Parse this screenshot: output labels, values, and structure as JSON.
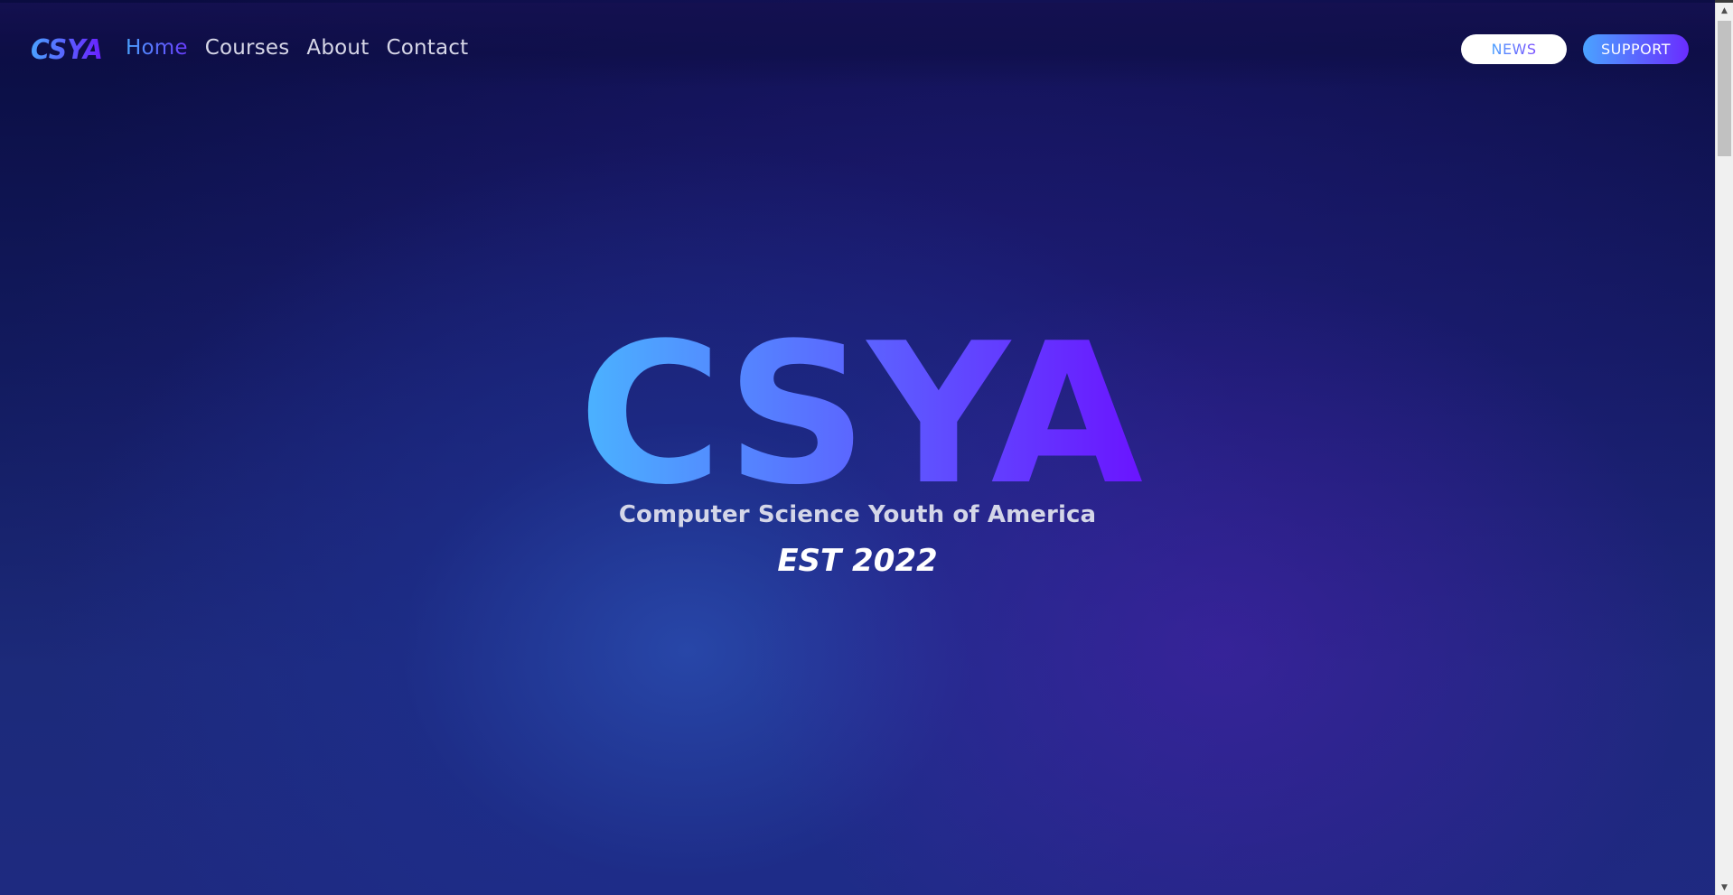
{
  "brand": {
    "logo_text": "CSYA",
    "gradient_start": "#4aa3ff",
    "gradient_end": "#6a1cff"
  },
  "nav": {
    "items": [
      {
        "label": "Home",
        "active": true
      },
      {
        "label": "Courses",
        "active": false
      },
      {
        "label": "About",
        "active": false
      },
      {
        "label": "Contact",
        "active": false
      }
    ]
  },
  "actions": {
    "news_label": "NEWS",
    "support_label": "SUPPORT"
  },
  "hero": {
    "title": "CSYA",
    "subtitle": "Computer Science Youth of America",
    "established": "EST 2022"
  },
  "scrollbar": {
    "up_icon": "triangle-up-icon",
    "down_icon": "triangle-down-icon"
  }
}
